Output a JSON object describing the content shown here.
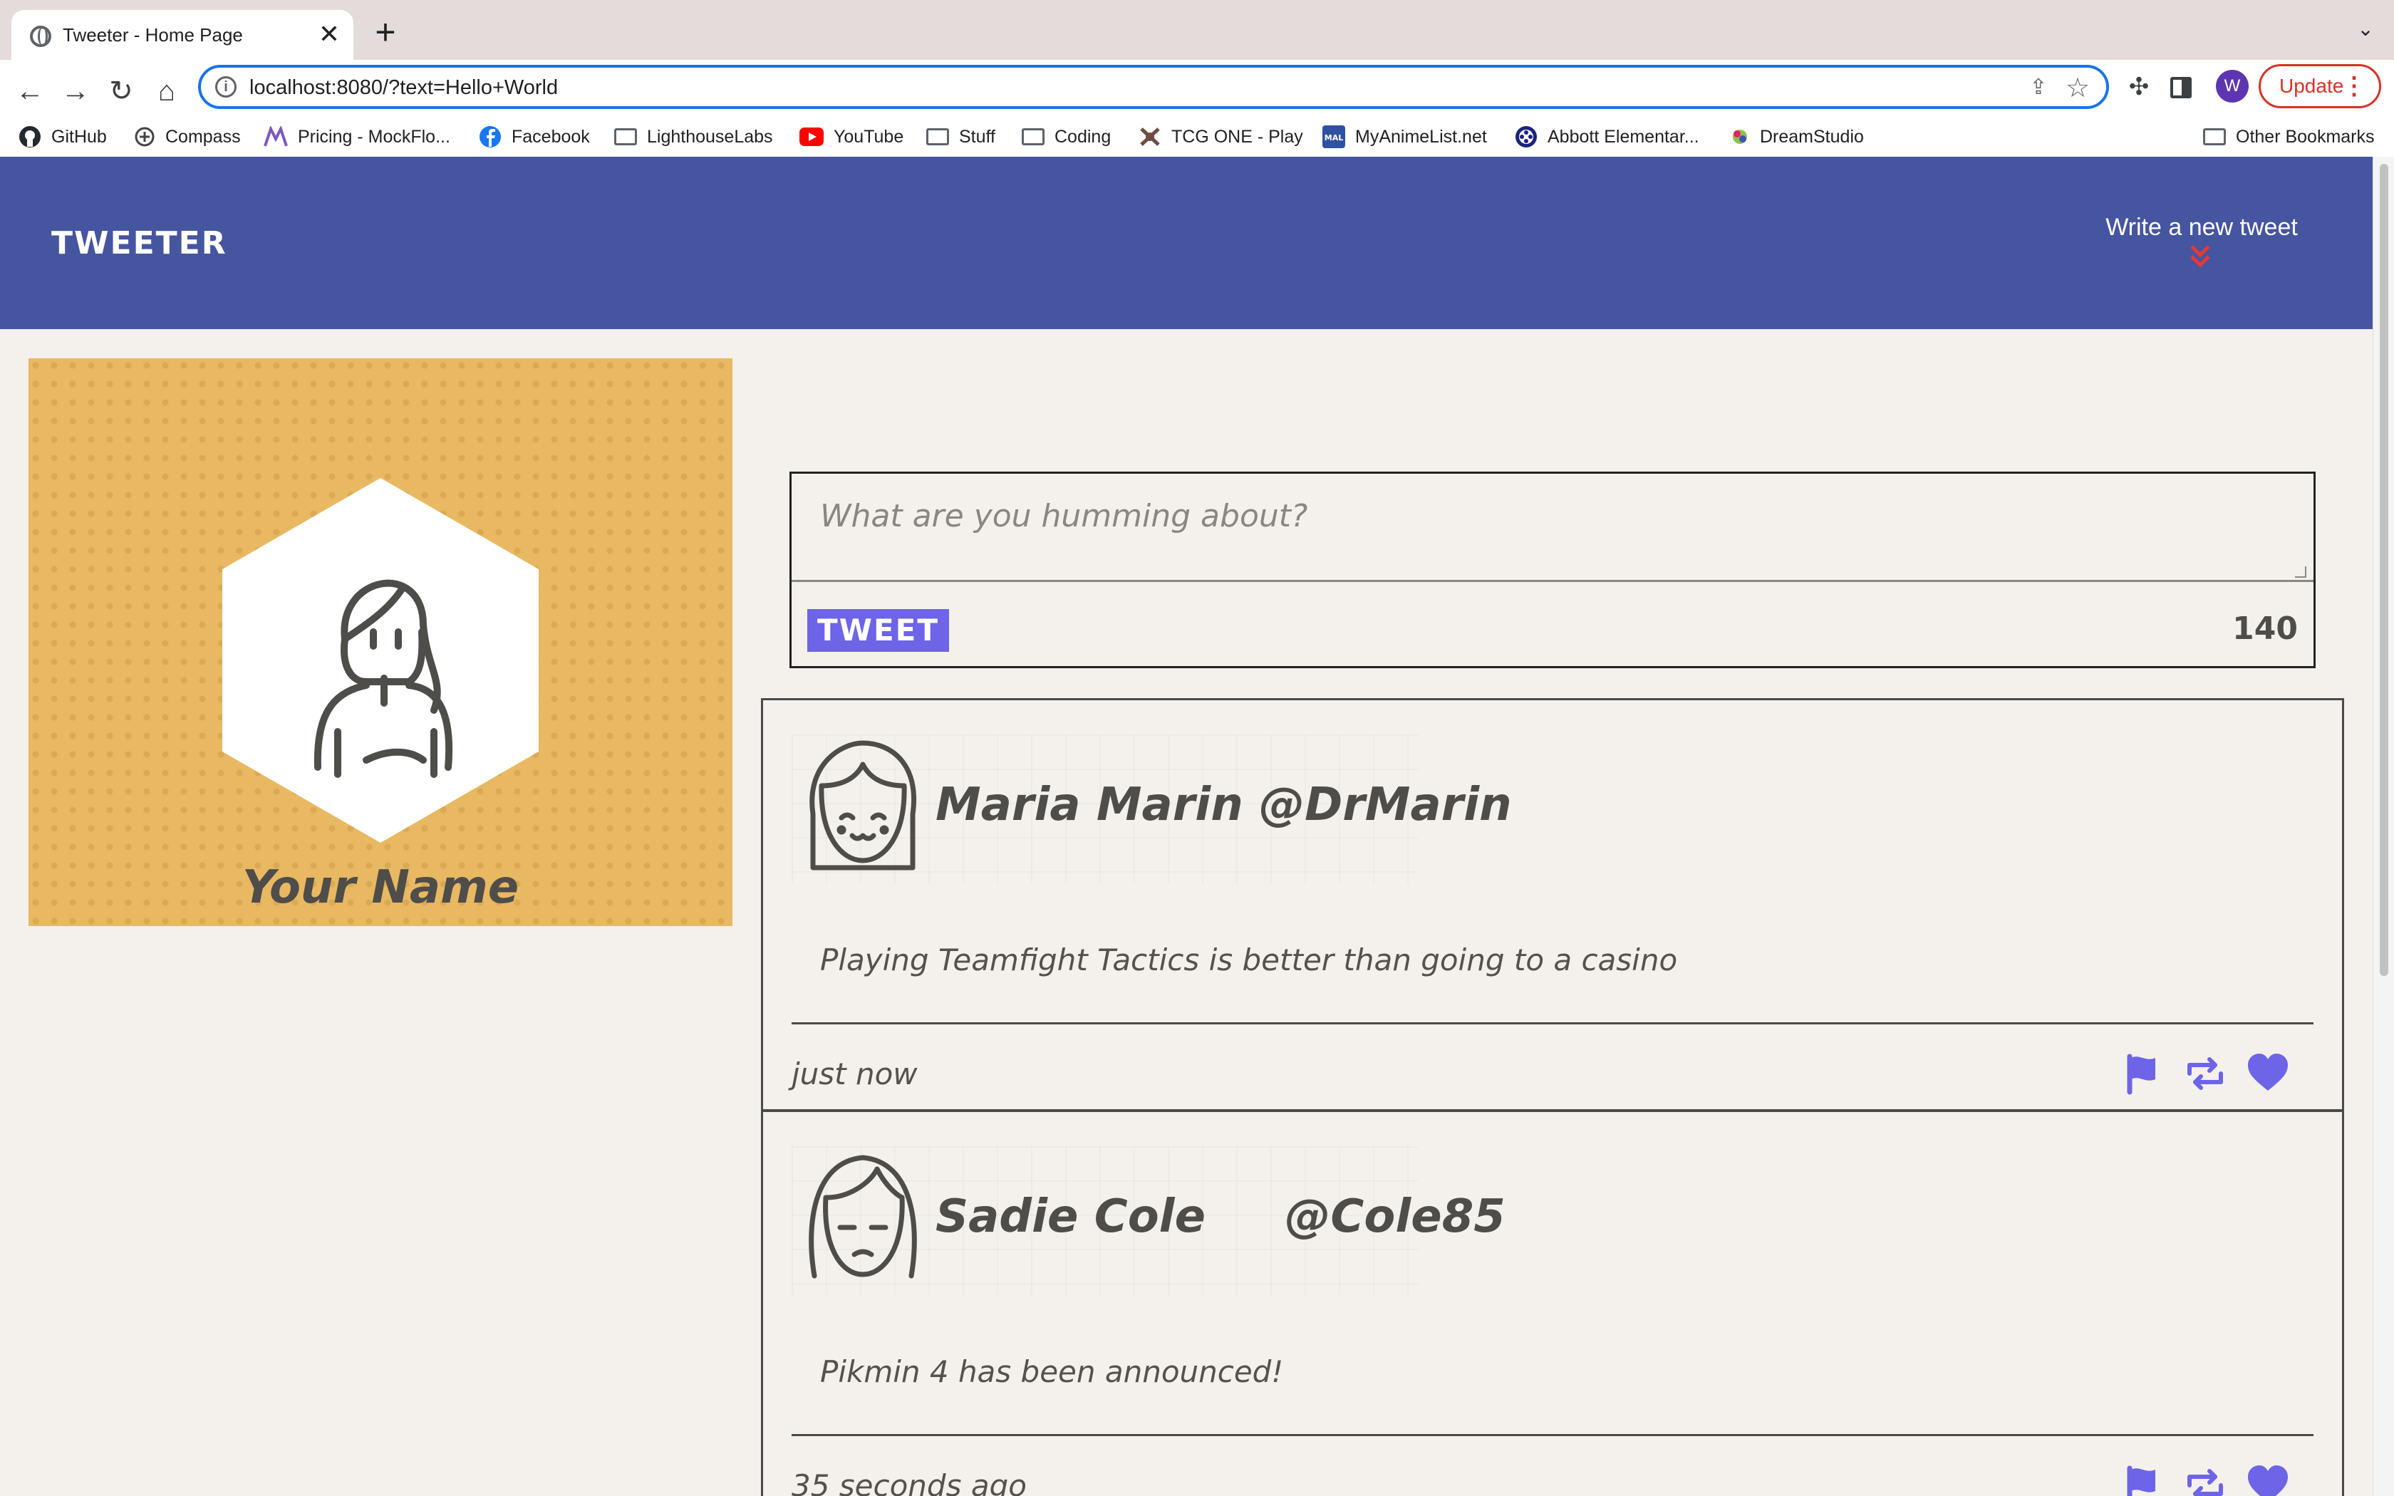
{
  "browser": {
    "tab_title": "Tweeter - Home Page",
    "tab_close": "✕",
    "new_tab": "+",
    "url": "localhost:8080/?text=Hello+World",
    "profile_initial": "W",
    "update_label": "Update",
    "bookmarks": [
      {
        "label": "GitHub",
        "icon": "github-icon",
        "color": "#24292f"
      },
      {
        "label": "Compass",
        "icon": "compass-icon",
        "color": "#444444"
      },
      {
        "label": "Pricing - MockFlo...",
        "icon": "mockflow-icon",
        "color": "#7e57c2"
      },
      {
        "label": "Facebook",
        "icon": "facebook-icon",
        "color": "#1877f2"
      },
      {
        "label": "LighthouseLabs",
        "icon": "folder-icon",
        "color": "#5f6368"
      },
      {
        "label": "YouTube",
        "icon": "youtube-icon",
        "color": "#ff0000"
      },
      {
        "label": "Stuff",
        "icon": "folder-icon",
        "color": "#5f6368"
      },
      {
        "label": "Coding",
        "icon": "folder-icon",
        "color": "#5f6368"
      },
      {
        "label": "TCG ONE - Play",
        "icon": "tcg-icon",
        "color": "#6d4c41"
      },
      {
        "label": "MyAnimeList.net",
        "icon": "mal-icon",
        "color": "#2e51a2"
      },
      {
        "label": "Abbott Elementar...",
        "icon": "film-icon",
        "color": "#1a237e"
      },
      {
        "label": "DreamStudio",
        "icon": "dreamstudio-icon",
        "color": "#8bc34a"
      }
    ],
    "other_bookmarks": "Other Bookmarks"
  },
  "site": {
    "logo": "TWEETER",
    "write_new": "Write a new tweet",
    "accent_color": "#4655a0",
    "chevron_color": "#e53935"
  },
  "profile": {
    "name": "Your Name",
    "background_color": "#e8b962"
  },
  "compose": {
    "placeholder": "What are you humming about?",
    "button_label": "TWEET",
    "button_color": "#6d64e8",
    "counter": "140"
  },
  "tweets": [
    {
      "name": "Maria Marin",
      "handle": "@DrMarin",
      "text": "Playing Teamfight Tactics is better than going to a casino",
      "time": "just now",
      "avatar": "smiling-girl-avatar"
    },
    {
      "name": "Sadie Cole",
      "handle": "@Cole85",
      "text": "Pikmin 4 has been announced!",
      "time": "35 seconds ago",
      "avatar": "sad-girl-avatar"
    }
  ],
  "tweet_actions": [
    "flag-icon",
    "retweet-icon",
    "heart-icon"
  ],
  "icon_color": "#6d64e8"
}
